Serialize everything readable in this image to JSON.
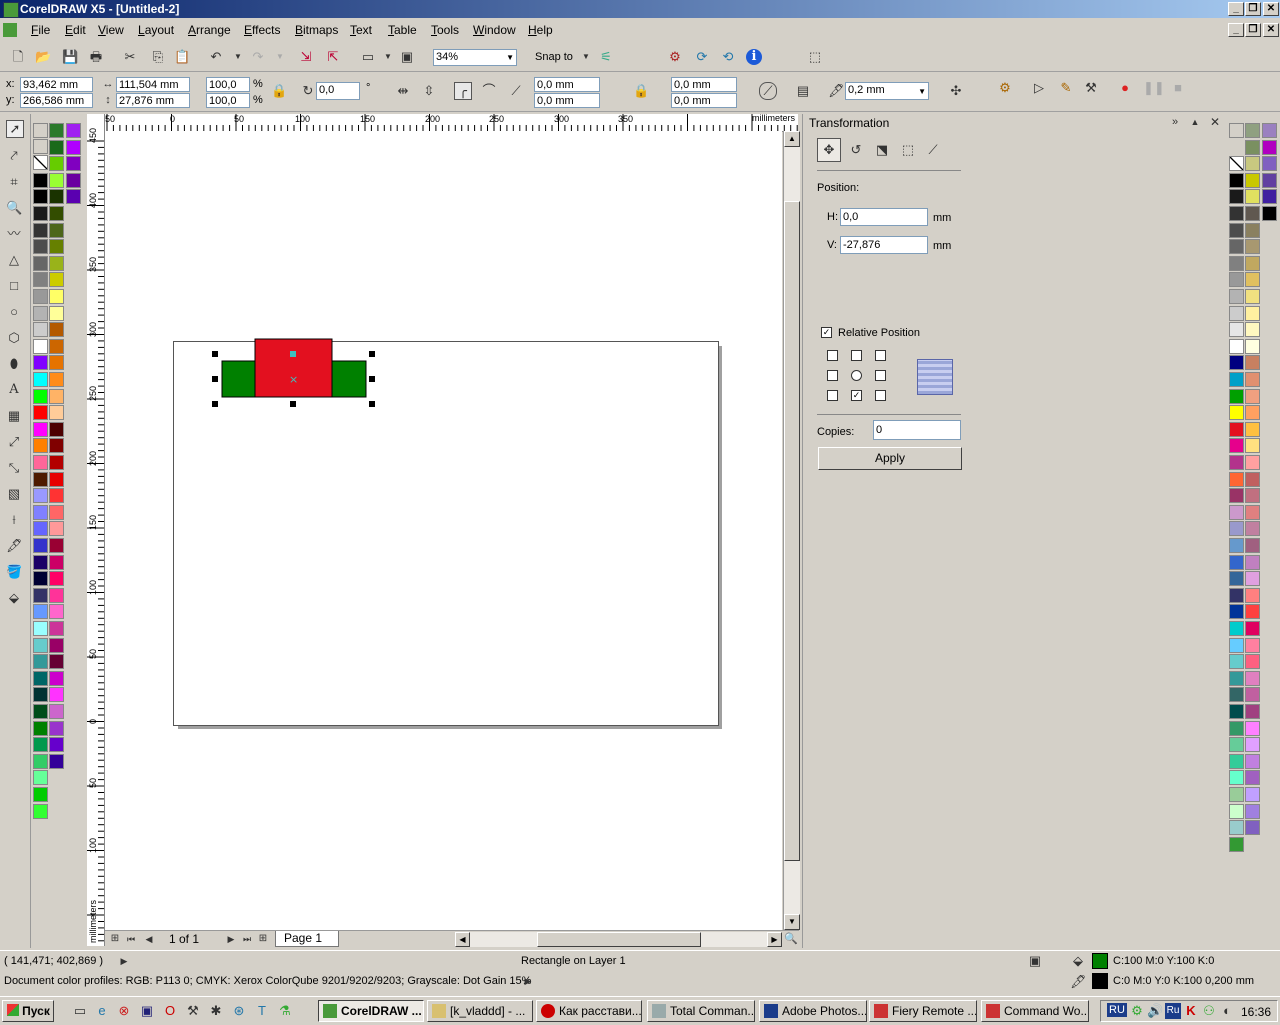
{
  "window": {
    "title": "CorelDRAW X5 - [Untitled-2]"
  },
  "menu": [
    "File",
    "Edit",
    "View",
    "Layout",
    "Arrange",
    "Effects",
    "Bitmaps",
    "Text",
    "Table",
    "Tools",
    "Window",
    "Help"
  ],
  "standard_toolbar": {
    "zoom": "34%",
    "snap_to": "Snap to"
  },
  "property_bar": {
    "x_label": "x:",
    "x": "93,462 mm",
    "y_label": "y:",
    "y": "266,586 mm",
    "width": "111,504 mm",
    "height": "27,876 mm",
    "scale_x": "100,0",
    "scale_y": "100,0",
    "pct": "%",
    "rotation": "0,0",
    "deg": "°",
    "corner1": "0,0 mm",
    "corner2": "0,0 mm",
    "corner3": "0,0 mm",
    "corner4": "0,0 mm",
    "outline_width": "0,2 mm"
  },
  "ruler": {
    "h_labels": [
      "50",
      "0",
      "50",
      "100",
      "150",
      "200",
      "250",
      "300",
      "350"
    ],
    "units": "millimeters",
    "v_labels": [
      "450",
      "400",
      "350",
      "300",
      "250",
      "200",
      "150",
      "100",
      "50",
      "0",
      "50",
      "100"
    ]
  },
  "page_nav": {
    "count": "1 of 1",
    "tab": "Page 1"
  },
  "docker": {
    "title": "Transformation",
    "position_label": "Position:",
    "h_label": "H:",
    "h_value": "0,0",
    "h_unit": "mm",
    "v_label": "V:",
    "v_value": "-27,876",
    "v_unit": "mm",
    "relative_position": "Relative Position",
    "copies_label": "Copies:",
    "copies_value": "0",
    "apply": "Apply"
  },
  "status": {
    "coords": "( 141,471; 402,869 )",
    "object": "Rectangle on Layer 1",
    "profiles": "Document color profiles: RGB: P113 0; CMYK: Xerox ColorQube 9201/9202/9203; Grayscale: Dot Gain 15%",
    "fill": "C:100 M:0 Y:100 K:0",
    "outline": "C:0 M:0 Y:0 K:100  0,200 mm",
    "fill_color": "#008000",
    "outline_color": "#000000"
  },
  "taskbar": {
    "start": "Пуск",
    "tasks": [
      "CorelDRAW ...",
      "[k_vladdd] - ...",
      "Как расстави...",
      "Total Comman...",
      "Adobe Photos...",
      "Fiery Remote ...",
      "Command Wo..."
    ],
    "lang": "RU",
    "clock": "16:36"
  },
  "colors": {
    "red_rect": "#e3101f",
    "green_rect": "#008000"
  }
}
